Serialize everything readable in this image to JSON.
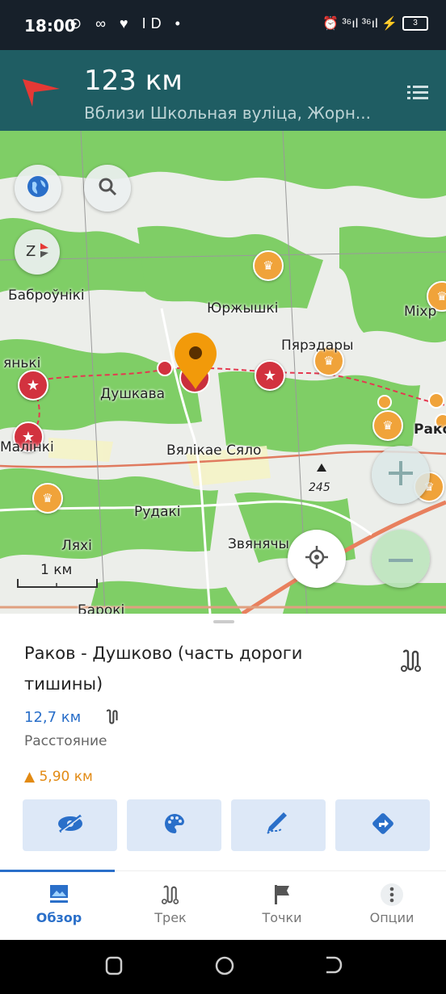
{
  "status_bar": {
    "time": "18:00",
    "left_icons": "⊙ ∞ ♥ ID •",
    "right_icons": "⏰ ³⁶ıl ³⁶ıl ⚡",
    "battery": "3"
  },
  "navigation": {
    "distance": "123 км",
    "address": "Вблизи Школьная вуліца, Жорн...",
    "arrow_color": "#e53935"
  },
  "map": {
    "places": [
      {
        "name": "Баброўнікі"
      },
      {
        "name": "Юржышкі"
      },
      {
        "name": "Міхр"
      },
      {
        "name": "Пярэдары"
      },
      {
        "name": "янькі"
      },
      {
        "name": "Душкава"
      },
      {
        "name": "Раком"
      },
      {
        "name": "Малінкі"
      },
      {
        "name": "Вялікае Сяло"
      },
      {
        "name": "245"
      },
      {
        "name": "Рудакі"
      },
      {
        "name": "Ляхі"
      },
      {
        "name": "Звянячы"
      },
      {
        "name": "Барокі"
      }
    ],
    "scale_label": "1 км",
    "icons": {
      "layers": "globe-icon",
      "search": "search-icon",
      "compass": "compass-icon",
      "zoom_in": "plus-icon",
      "zoom_out": "minus-icon",
      "locate": "my-location-icon"
    }
  },
  "track": {
    "title": "Раков - Душково (часть дороги тишины)",
    "distance_value": "12,7 км",
    "distance_label": "Расстояние",
    "elevation": "▲  5,90 км",
    "actions": [
      "hide-icon",
      "palette-icon",
      "edit-icon",
      "navigate-icon"
    ]
  },
  "tabs": [
    {
      "label": "Обзор",
      "icon": "overview-icon",
      "active": true
    },
    {
      "label": "Трек",
      "icon": "track-icon",
      "active": false
    },
    {
      "label": "Точки",
      "icon": "flag-icon",
      "active": false
    },
    {
      "label": "Опции",
      "icon": "more-icon",
      "active": false
    }
  ],
  "colors": {
    "accent": "#2a6fc9",
    "header": "#1f5d63",
    "forest": "#7bcf63",
    "poi_star": "#d2323f",
    "poi_orange": "#f0a33a",
    "marker": "#f29a0a"
  }
}
